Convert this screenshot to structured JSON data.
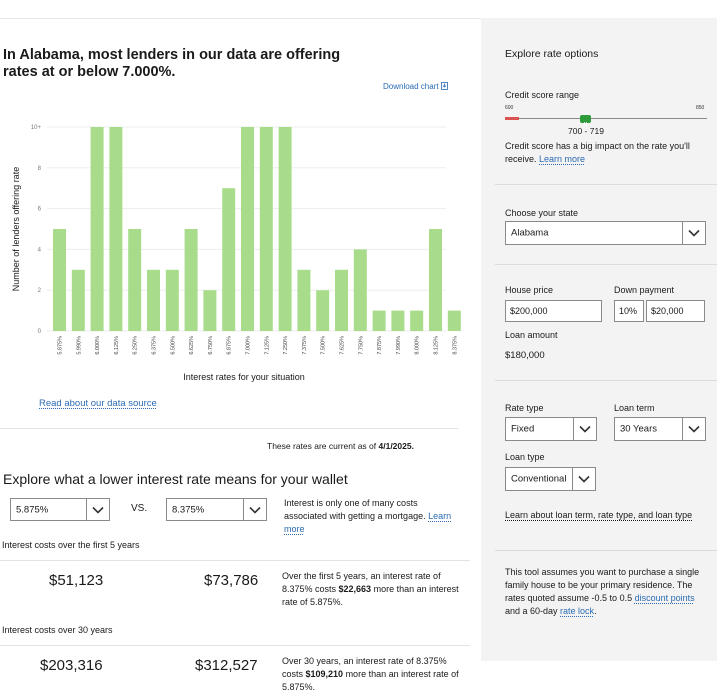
{
  "headline": "In Alabama, most lenders in our data are offering rates at or below 7.000%.",
  "download_label": "Download chart",
  "chart_data": {
    "type": "bar",
    "xlabel": "Interest rates for your situation",
    "ylabel": "Number of lenders offering rate",
    "y_ticks": [
      "0",
      "2",
      "4",
      "6",
      "8",
      "10+"
    ],
    "ylim": [
      0,
      10
    ],
    "grid": true,
    "bar_color": "#a8dc8a",
    "categories": [
      "5.875%",
      "5.990%",
      "6.000%",
      "6.125%",
      "6.250%",
      "6.375%",
      "6.500%",
      "6.625%",
      "6.750%",
      "6.875%",
      "7.000%",
      "7.125%",
      "7.250%",
      "7.375%",
      "7.500%",
      "7.625%",
      "7.750%",
      "7.875%",
      "7.990%",
      "8.000%",
      "8.125%",
      "8.375%"
    ],
    "values": [
      5,
      3,
      10,
      10,
      5,
      3,
      3,
      5,
      2,
      7,
      10,
      10,
      10,
      3,
      2,
      3,
      4,
      1,
      1,
      1,
      5,
      1
    ]
  },
  "read_source": "Read about our data source",
  "current_prefix": "These rates are current as of ",
  "current_date": "4/1/2025.",
  "explore_title": "Explore what a lower interest rate means for your wallet",
  "compare": {
    "rate_a": "5.875%",
    "vs": "VS.",
    "rate_b": "8.375%",
    "note": "Interest is only one of many costs associated with getting a mortgage.",
    "learn_more": "Learn more"
  },
  "five_year": {
    "label": "Interest costs over the first 5 years",
    "value_a": "$51,123",
    "value_b": "$73,786",
    "desc_1": "Over the first 5 years, an interest rate of 8.375% costs ",
    "desc_bold": "$22,663",
    "desc_2": " more than an interest rate of 5.875%."
  },
  "thirty_year": {
    "label": "Interest costs over 30 years",
    "value_a": "$203,316",
    "value_b": "$312,527",
    "desc_1": "Over 30 years, an interest rate of 8.375% costs ",
    "desc_bold": "$109,210",
    "desc_2": " more than an interest rate of 5.875%."
  },
  "panel": {
    "title": "Explore rate options",
    "credit_label": "Credit score range",
    "credit_min": "600",
    "credit_max": "850",
    "credit_value": "700 - 719",
    "credit_position": 0.4,
    "credit_note": "Credit score has a big impact on the rate you'll receive. ",
    "credit_learn": "Learn more",
    "state_label": "Choose your state",
    "state_value": "Alabama",
    "house_label": "House price",
    "house_value": "$200,000",
    "down_label": "Down payment",
    "down_pct": "10%",
    "down_value": "$20,000",
    "loan_amount_label": "Loan amount",
    "loan_amount_value": "$180,000",
    "rate_type_label": "Rate type",
    "rate_type_value": "Fixed",
    "loan_term_label": "Loan term",
    "loan_term_value": "30 Years",
    "loan_type_label": "Loan type",
    "loan_type_value": "Conventional",
    "learn_loan": "Learn about loan term, rate type, and loan type",
    "assume_1": "This tool assumes you want to purchase a single family house to be your primary residence. The rates quoted assume -0.5 to 0.5 ",
    "assume_link_1": "discount points",
    "assume_2": " and a 60-day ",
    "assume_link_2": "rate lock",
    "assume_3": "."
  },
  "colors": {
    "accent_green": "#2e9b3a",
    "slider_red": "#d9534f",
    "link": "#2b6bb3"
  }
}
